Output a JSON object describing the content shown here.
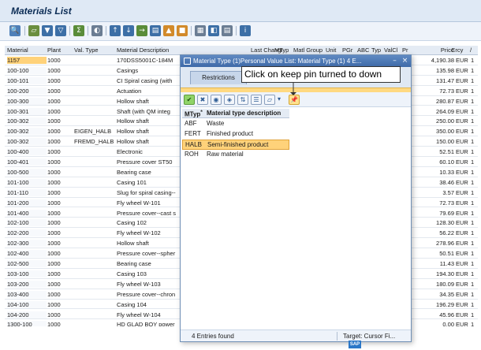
{
  "window": {
    "title": "Materials List"
  },
  "toolbar": {
    "buttons": [
      "details-icon",
      "print-icon",
      "filter-icon",
      "filter-settings-icon",
      "sum-icon",
      "layout-icon",
      "sort-ascending-icon",
      "sort-descending-icon",
      "export-icon",
      "find-icon",
      "abc-analysis-icon",
      "graphic-icon",
      "grid-icon",
      "change-layout-icon",
      "select-layout-icon",
      "info-icon"
    ]
  },
  "columns": [
    "Material",
    "Plant",
    "Val. Type",
    "Material Description",
    "Last Change",
    "MTyp",
    "Matl Group",
    "Unit",
    "PGr",
    "ABC",
    "Typ",
    "ValCl",
    "Pr",
    "Price",
    "Crcy",
    "/"
  ],
  "rows": [
    {
      "material": "1157",
      "plant": "1000",
      "val_type": "",
      "description": "170DSS5001C-184M",
      "price": "4,190.38",
      "crcy": "EUR",
      "per": "1"
    },
    {
      "material": "100-100",
      "plant": "1000",
      "val_type": "",
      "description": "Casings",
      "price": "135.98",
      "crcy": "EUR",
      "per": "1"
    },
    {
      "material": "100-101",
      "plant": "1000",
      "val_type": "",
      "description": "CI Spiral casing  (with",
      "price": "131.47",
      "crcy": "EUR",
      "per": "1"
    },
    {
      "material": "100-200",
      "plant": "1000",
      "val_type": "",
      "description": "Actuation",
      "price": "72.73",
      "crcy": "EUR",
      "per": "1"
    },
    {
      "material": "100-300",
      "plant": "1000",
      "val_type": "",
      "description": "Hollow shaft",
      "price": "280.87",
      "crcy": "EUR",
      "per": "1"
    },
    {
      "material": "100-301",
      "plant": "1000",
      "val_type": "",
      "description": "Shaft (with QM integ",
      "price": "264.09",
      "crcy": "EUR",
      "per": "1"
    },
    {
      "material": "100-302",
      "plant": "1000",
      "val_type": "",
      "description": "Hollow shaft",
      "price": "250.00",
      "crcy": "EUR",
      "per": "1"
    },
    {
      "material": "100-302",
      "plant": "1000",
      "val_type": "EIGEN_HALB",
      "description": "Hollow shaft",
      "price": "350.00",
      "crcy": "EUR",
      "per": "1"
    },
    {
      "material": "100-302",
      "plant": "1000",
      "val_type": "FREMD_HALB",
      "description": "Hollow shaft",
      "price": "150.00",
      "crcy": "EUR",
      "per": "1"
    },
    {
      "material": "100-400",
      "plant": "1000",
      "val_type": "",
      "description": "Electronic",
      "price": "52.51",
      "crcy": "EUR",
      "per": "1"
    },
    {
      "material": "100-401",
      "plant": "1000",
      "val_type": "",
      "description": "Pressure cover ST50",
      "price": "60.10",
      "crcy": "EUR",
      "per": "1"
    },
    {
      "material": "100-500",
      "plant": "1000",
      "val_type": "",
      "description": "Bearing case",
      "price": "10.33",
      "crcy": "EUR",
      "per": "1"
    },
    {
      "material": "101-100",
      "plant": "1000",
      "val_type": "",
      "description": "Casing  101",
      "price": "38.46",
      "crcy": "EUR",
      "per": "1"
    },
    {
      "material": "101-110",
      "plant": "1000",
      "val_type": "",
      "description": "Slug for spiral casing--",
      "price": "3.57",
      "crcy": "EUR",
      "per": "1"
    },
    {
      "material": "101-200",
      "plant": "1000",
      "val_type": "",
      "description": "Fly wheel W-101",
      "price": "72.73",
      "crcy": "EUR",
      "per": "1"
    },
    {
      "material": "101-400",
      "plant": "1000",
      "val_type": "",
      "description": "Pressure cover--cast s",
      "price": "79.69",
      "crcy": "EUR",
      "per": "1"
    },
    {
      "material": "102-100",
      "plant": "1000",
      "val_type": "",
      "description": "Casing 102",
      "price": "128.30",
      "crcy": "EUR",
      "per": "1"
    },
    {
      "material": "102-200",
      "plant": "1000",
      "val_type": "",
      "description": "Fly wheel W-102",
      "price": "56.22",
      "crcy": "EUR",
      "per": "1"
    },
    {
      "material": "102-300",
      "plant": "1000",
      "val_type": "",
      "description": "Hollow shaft",
      "price": "278.96",
      "crcy": "EUR",
      "per": "1"
    },
    {
      "material": "102-400",
      "plant": "1000",
      "val_type": "",
      "description": "Pressure cover--spher",
      "price": "50.51",
      "crcy": "EUR",
      "per": "1"
    },
    {
      "material": "102-500",
      "plant": "1000",
      "val_type": "",
      "description": "Bearing case",
      "price": "11.43",
      "crcy": "EUR",
      "per": "1"
    },
    {
      "material": "103-100",
      "plant": "1000",
      "val_type": "",
      "description": "Casing 103",
      "price": "194.30",
      "crcy": "EUR",
      "per": "1"
    },
    {
      "material": "103-200",
      "plant": "1000",
      "val_type": "",
      "description": "Fly wheel W-103",
      "price": "180.09",
      "crcy": "EUR",
      "per": "1"
    },
    {
      "material": "103-400",
      "plant": "1000",
      "val_type": "",
      "description": "Pressure cover--chron",
      "price": "34.35",
      "crcy": "EUR",
      "per": "1"
    },
    {
      "material": "104-100",
      "plant": "1000",
      "val_type": "",
      "description": "Casing 104",
      "price": "196.29",
      "crcy": "EUR",
      "per": "1"
    },
    {
      "material": "104-200",
      "plant": "1000",
      "val_type": "",
      "description": "Fly wheel W-104",
      "price": "45.96",
      "crcy": "EUR",
      "per": "1"
    },
    {
      "material": "1300-100",
      "plant": "1000",
      "val_type": "",
      "description": "HD GLAD BOY power",
      "price": "0.00",
      "crcy": "EUR",
      "per": "1"
    }
  ],
  "popup": {
    "title": "Material Type (1)Personal Value List: Material Type (1)   4 E...",
    "tab": "Restrictions",
    "buttons": [
      "check-icon",
      "cancel-icon",
      "find-icon",
      "find-next-icon",
      "sort-icon",
      "list-icon",
      "print-icon",
      "keep-pin-icon"
    ],
    "list_header": {
      "col1": "MTyp",
      "col1_mark": "*",
      "col2": "Material type description"
    },
    "items": [
      {
        "code": "ABF",
        "desc": "Waste"
      },
      {
        "code": "FERT",
        "desc": "Finished product"
      },
      {
        "code": "HALB",
        "desc": "Semi-finished product"
      },
      {
        "code": "ROH",
        "desc": "Raw material"
      }
    ],
    "status_left": "4 Entries found",
    "status_right": "Target: Cursor Fi..."
  },
  "callout": {
    "text": "Click on keep pin turned to down"
  },
  "logo": "SAP",
  "colors": {
    "selection": "#ffd27a",
    "header_bg": "#e4ebf4",
    "title_bar": "#3e6aa8"
  }
}
